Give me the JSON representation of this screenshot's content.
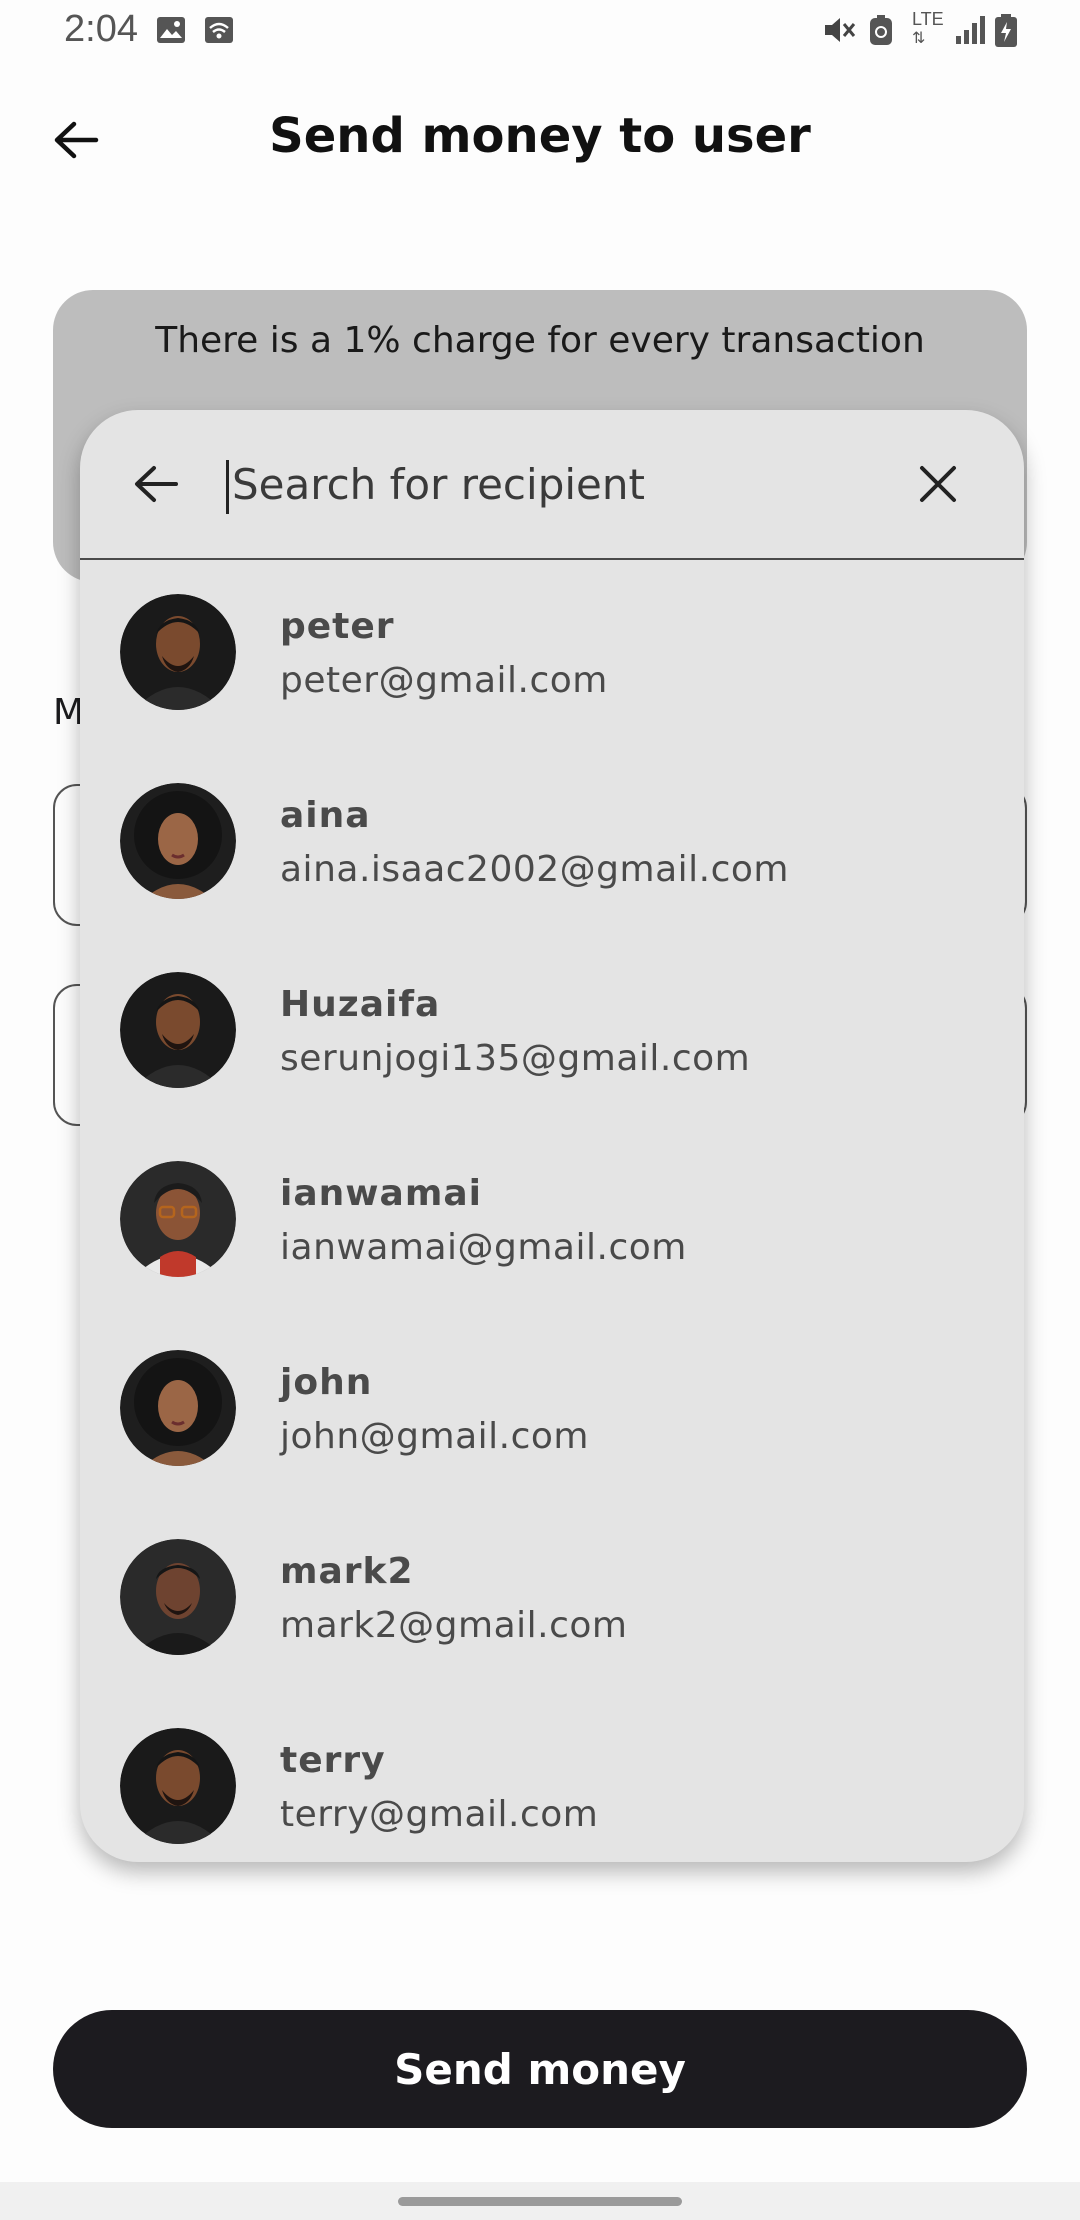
{
  "status_bar": {
    "time": "2:04",
    "network_label": "LTE",
    "icons": [
      "image-icon",
      "wifi-icon",
      "mute-icon",
      "data-saver-icon",
      "lte-icon",
      "signal-icon",
      "battery-charging-icon"
    ]
  },
  "header": {
    "title": "Send money to user",
    "back_icon": "arrow-left-icon"
  },
  "notice": {
    "text": "There is a 1% charge for every transaction"
  },
  "form": {
    "section_label_partial": "M"
  },
  "search": {
    "placeholder": "Search for recipient",
    "value": "",
    "back_icon": "arrow-left-icon",
    "clear_icon": "close-icon"
  },
  "recipients": [
    {
      "name": "peter",
      "email": "peter@gmail.com"
    },
    {
      "name": "aina",
      "email": "aina.isaac2002@gmail.com"
    },
    {
      "name": "Huzaifa",
      "email": "serunjogi135@gmail.com"
    },
    {
      "name": "ianwamai",
      "email": "ianwamai@gmail.com"
    },
    {
      "name": "john",
      "email": "john@gmail.com"
    },
    {
      "name": "mark2",
      "email": "mark2@gmail.com"
    },
    {
      "name": "terry",
      "email": "terry@gmail.com"
    }
  ],
  "actions": {
    "send_label": "Send money"
  },
  "colors": {
    "primary_button": "#1c1b1f",
    "search_panel": "#e4e4e4",
    "notice_card": "#bdbdbd"
  }
}
